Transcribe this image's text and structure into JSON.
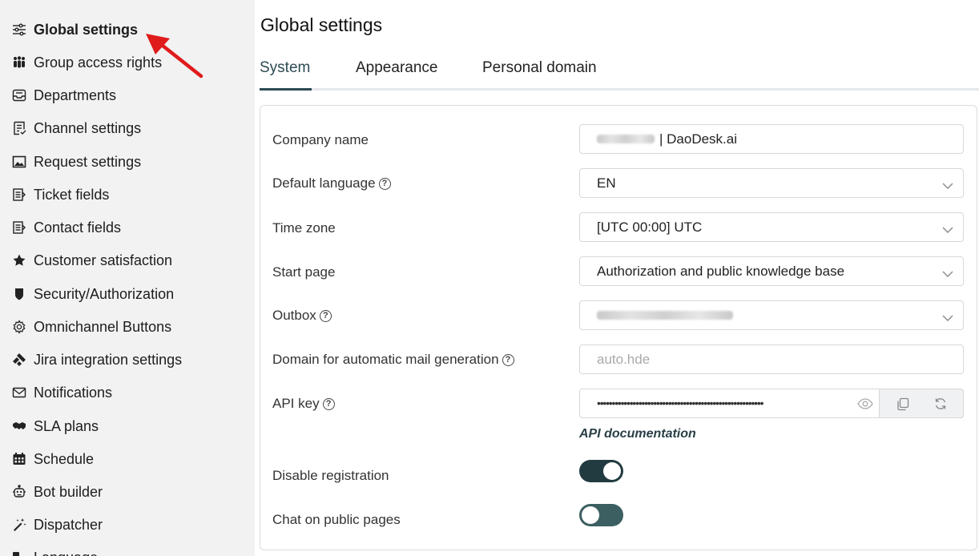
{
  "sidebar": {
    "items": [
      {
        "label": "Global settings",
        "icon": "sliders-icon",
        "active": true
      },
      {
        "label": "Group access rights",
        "icon": "group-icon"
      },
      {
        "label": "Departments",
        "icon": "inbox-icon"
      },
      {
        "label": "Channel settings",
        "icon": "list-checklist-icon"
      },
      {
        "label": "Request settings",
        "icon": "image-window-icon"
      },
      {
        "label": "Ticket fields",
        "icon": "form-fields-icon"
      },
      {
        "label": "Contact fields",
        "icon": "form-fields-icon"
      },
      {
        "label": "Customer satisfaction",
        "icon": "star-icon"
      },
      {
        "label": "Security/Authorization",
        "icon": "shield-icon"
      },
      {
        "label": "Omnichannel Buttons",
        "icon": "gear-icon"
      },
      {
        "label": "Jira integration settings",
        "icon": "jira-icon"
      },
      {
        "label": "Notifications",
        "icon": "envelope-icon"
      },
      {
        "label": "SLA plans",
        "icon": "handshake-icon"
      },
      {
        "label": "Schedule",
        "icon": "calendar-icon"
      },
      {
        "label": "Bot builder",
        "icon": "robot-icon"
      },
      {
        "label": "Dispatcher",
        "icon": "magic-wand-icon"
      },
      {
        "label": "Language",
        "icon": "language-icon"
      }
    ]
  },
  "main": {
    "title": "Global settings",
    "tabs": [
      {
        "label": "System",
        "active": true
      },
      {
        "label": "Appearance"
      },
      {
        "label": "Personal domain"
      }
    ],
    "form": {
      "company_name": {
        "label": "Company name",
        "value_suffix": "| DaoDesk.ai"
      },
      "default_language": {
        "label": "Default language",
        "value": "EN"
      },
      "time_zone": {
        "label": "Time zone",
        "value": "[UTC 00:00] UTC"
      },
      "start_page": {
        "label": "Start page",
        "value": "Authorization and public knowledge base"
      },
      "outbox": {
        "label": "Outbox"
      },
      "mail_domain": {
        "label": "Domain for automatic mail generation",
        "placeholder": "auto.hde"
      },
      "api_key": {
        "label": "API key",
        "masked": "••••••••••••••••••••••••••••••••••••••••••••••••••••••••",
        "doc_link": "API documentation"
      },
      "disable_registration": {
        "label": "Disable registration",
        "enabled": true
      },
      "chat_public": {
        "label": "Chat on public pages",
        "enabled": false
      }
    },
    "help_glyph": "?"
  },
  "colors": {
    "accent": "#2d4a52",
    "toggle_on": "#223b41",
    "toggle_off": "#3c5f62",
    "sidebar_bg": "#f2f2f2",
    "arrow": "#e01b1b"
  }
}
